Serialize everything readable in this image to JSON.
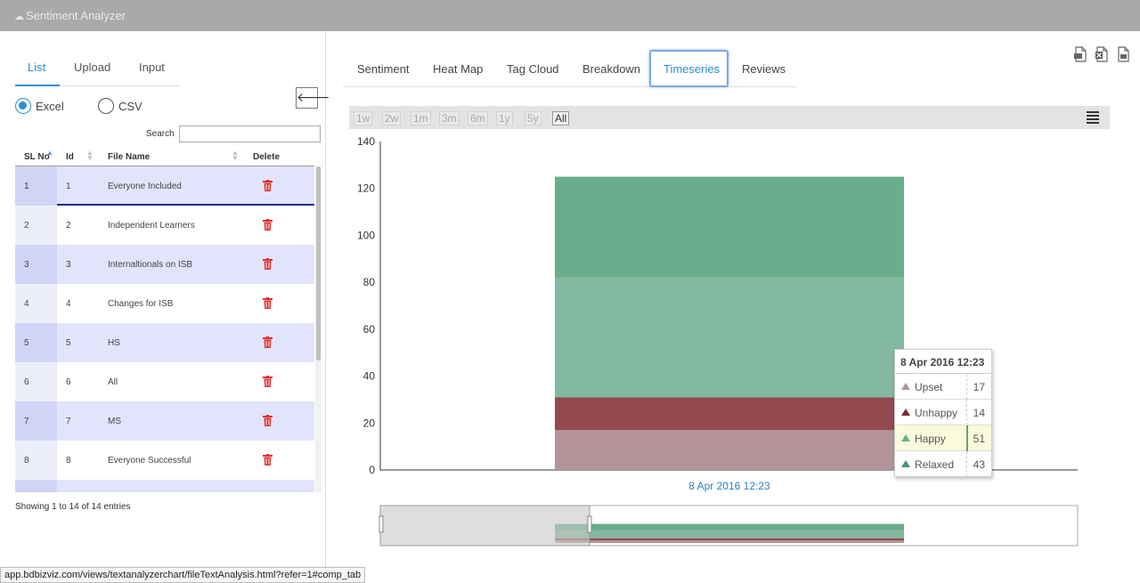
{
  "app": {
    "title": "Sentiment Analyzer"
  },
  "left": {
    "tabs": [
      {
        "label": "List"
      },
      {
        "label": "Upload"
      },
      {
        "label": "Input"
      }
    ],
    "radios": [
      {
        "label": "Excel",
        "checked": true
      },
      {
        "label": "CSV",
        "checked": false
      }
    ],
    "search": {
      "label": "Search",
      "value": ""
    },
    "columns": {
      "sl": "SL No",
      "id": "Id",
      "file": "File Name",
      "delete": "Delete"
    },
    "rows": [
      {
        "sl": "1",
        "id": "1",
        "name": "Everyone Included"
      },
      {
        "sl": "2",
        "id": "2",
        "name": "Independent Learners"
      },
      {
        "sl": "3",
        "id": "3",
        "name": "Internaltionals on ISB"
      },
      {
        "sl": "4",
        "id": "4",
        "name": "Changes for ISB"
      },
      {
        "sl": "5",
        "id": "5",
        "name": "HS"
      },
      {
        "sl": "6",
        "id": "6",
        "name": "All"
      },
      {
        "sl": "7",
        "id": "7",
        "name": "MS"
      },
      {
        "sl": "8",
        "id": "8",
        "name": "Everyone Successful"
      }
    ],
    "footer": "Showing 1 to 14 of 14 entries"
  },
  "right": {
    "tabs": [
      {
        "label": "Sentiment"
      },
      {
        "label": "Heat Map"
      },
      {
        "label": "Tag Cloud"
      },
      {
        "label": "Breakdown"
      },
      {
        "label": "Timeseries"
      },
      {
        "label": "Reviews"
      }
    ],
    "active_tab": "Timeseries",
    "export_icons": [
      "pdf-export-icon",
      "excel-export-icon",
      "csv-export-icon"
    ],
    "range_buttons": [
      {
        "label": "1w"
      },
      {
        "label": "2w"
      },
      {
        "label": "1m"
      },
      {
        "label": "3m"
      },
      {
        "label": "6m"
      },
      {
        "label": "1y"
      },
      {
        "label": "5y"
      },
      {
        "label": "All"
      }
    ],
    "active_range": "All"
  },
  "chart_data": {
    "type": "bar",
    "stacked": true,
    "categories": [
      "8 Apr 2016 12:23"
    ],
    "series": [
      {
        "name": "Upset",
        "values": [
          17
        ],
        "color": "#b3939a"
      },
      {
        "name": "Unhappy",
        "values": [
          14
        ],
        "color": "#924a4f"
      },
      {
        "name": "Happy",
        "values": [
          51
        ],
        "color": "#82b9a0"
      },
      {
        "name": "Relaxed",
        "values": [
          43
        ],
        "color": "#68ae8a"
      }
    ],
    "ylim": [
      0,
      140
    ],
    "yticks": [
      0,
      20,
      40,
      60,
      80,
      100,
      120,
      140
    ],
    "grid": false,
    "tooltip": {
      "header": "8 Apr 2016 12:23",
      "highlighted": "Happy"
    }
  },
  "statusbar": {
    "url": "app.bdbizviz.com/views/textanalyzerchart/fileTextAnalysis.html?refer=1#comp_tab"
  }
}
